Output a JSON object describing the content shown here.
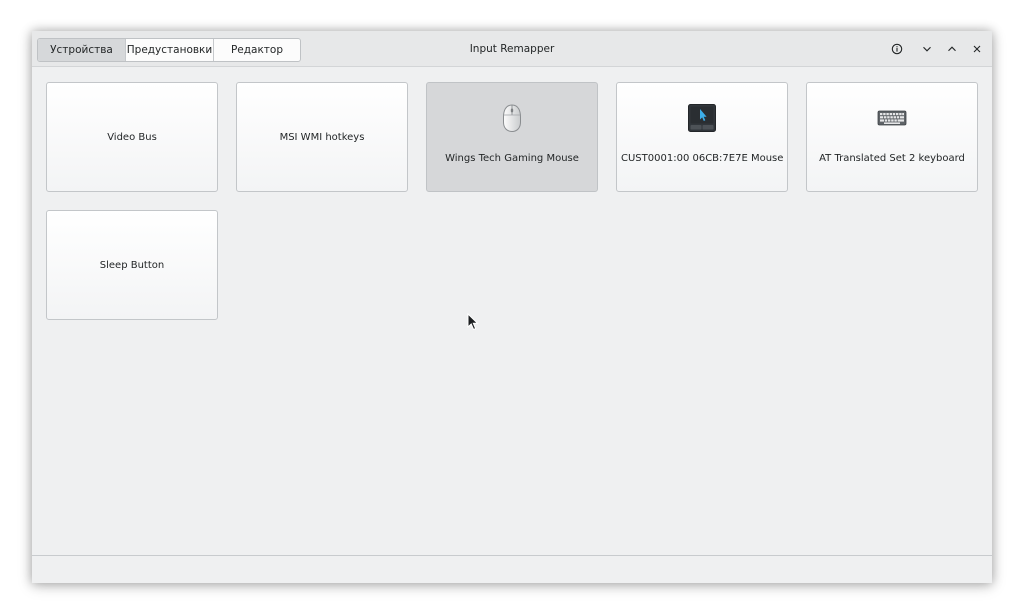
{
  "window": {
    "title": "Input Remapper"
  },
  "tabs": [
    {
      "label": "Устройства",
      "active": true
    },
    {
      "label": "Предустановки",
      "active": false
    },
    {
      "label": "Редактор",
      "active": false
    }
  ],
  "window_controls": {
    "info_icon": "info-icon",
    "minimize_icon": "chevron-down-icon",
    "maximize_icon": "chevron-up-icon",
    "close_icon": "close-icon"
  },
  "devices": [
    {
      "label": "Video Bus",
      "icon": null,
      "selected": false
    },
    {
      "label": "MSI WMI hotkeys",
      "icon": null,
      "selected": false
    },
    {
      "label": "Wings Tech Gaming Mouse",
      "icon": "mouse-icon",
      "selected": true
    },
    {
      "label": "CUST0001:00 06CB:7E7E Mouse",
      "icon": "touchpad-icon",
      "selected": false
    },
    {
      "label": "AT Translated Set 2 keyboard",
      "icon": "keyboard-icon",
      "selected": false
    },
    {
      "label": "Sleep Button",
      "icon": null,
      "selected": false
    }
  ],
  "colors": {
    "window_bg": "#eff0f1",
    "selected_card": "#d6d7d9",
    "touchpad_accent": "#3daee9"
  }
}
